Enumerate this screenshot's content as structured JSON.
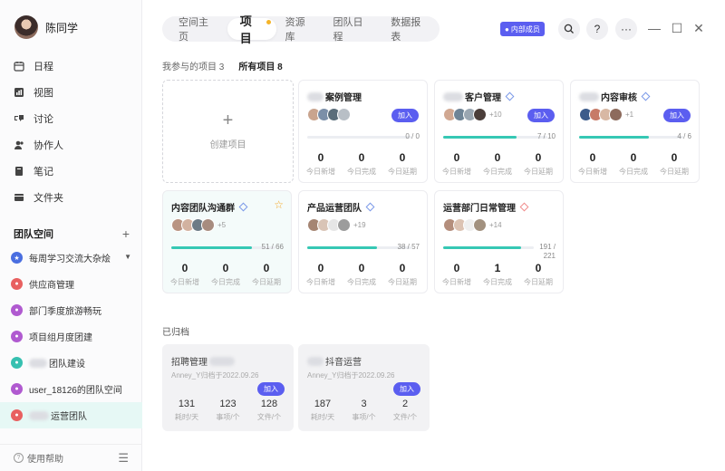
{
  "user": {
    "name": "陈同学"
  },
  "nav": [
    {
      "label": "日程",
      "icon": "calendar-icon"
    },
    {
      "label": "视图",
      "icon": "chart-icon"
    },
    {
      "label": "讨论",
      "icon": "discussion-icon"
    },
    {
      "label": "协作人",
      "icon": "people-icon"
    },
    {
      "label": "笔记",
      "icon": "notebook-icon"
    },
    {
      "label": "文件夹",
      "icon": "folder-icon"
    }
  ],
  "team_space": {
    "title": "团队空间",
    "add": "+",
    "items": [
      {
        "label": "每周学习交流大杂烩",
        "icon_color": "#4a6ee0"
      },
      {
        "label": "供应商管理",
        "icon_color": "#e86060"
      },
      {
        "label": "部门季度旅游畅玩",
        "icon_color": "#b05ad0"
      },
      {
        "label": "项目组月度团建",
        "icon_color": "#b05ad0"
      },
      {
        "label": "团队建设",
        "icon_color": "#36c0b0"
      },
      {
        "label": "user_18126的团队空间",
        "icon_color": "#b05ad0"
      },
      {
        "label": "运营团队",
        "icon_color": "#e86060"
      }
    ]
  },
  "footer": {
    "help": "使用帮助"
  },
  "tabs": [
    "空间主页",
    "项目",
    "资源库",
    "团队日程",
    "数据报表"
  ],
  "member_badge": "内部成员",
  "filter": {
    "mine": "我参与的项目 3",
    "all": "所有项目 8"
  },
  "create_label": "创建项目",
  "stat_labels": [
    "今日新增",
    "今日完成",
    "今日延期"
  ],
  "join_label": "加入",
  "projects": [
    {
      "title": "案例管理",
      "progress_text": "0 / 0",
      "progress": 0,
      "avatars_extra": "",
      "stats": [
        "0",
        "0",
        "0"
      ]
    },
    {
      "title": "客户管理",
      "progress_text": "7 / 10",
      "progress": 0.7,
      "avatars_extra": "+10",
      "stats": [
        "0",
        "0",
        "0"
      ]
    },
    {
      "title": "内容审核",
      "progress_text": "4 / 6",
      "progress": 0.67,
      "avatars_extra": "+1",
      "stats": [
        "0",
        "0",
        "0"
      ]
    },
    {
      "title": "内容团队沟通群",
      "progress_text": "51 / 66",
      "progress": 0.77,
      "avatars_extra": "+5",
      "stats": [
        "0",
        "0",
        "0"
      ]
    },
    {
      "title": "产品运营团队",
      "progress_text": "38 / 57",
      "progress": 0.67,
      "avatars_extra": "+19",
      "stats": [
        "0",
        "0",
        "0"
      ]
    },
    {
      "title": "运营部门日常管理",
      "progress_text": "191 / 221",
      "progress": 0.86,
      "avatars_extra": "+14",
      "stats": [
        "0",
        "1",
        "0"
      ]
    }
  ],
  "archived": {
    "title": "已归档",
    "stat_labels": [
      "耗时/天",
      "事项/个",
      "文件/个"
    ],
    "items": [
      {
        "title": "招聘管理",
        "sub": "Anney_Y归档于2022.09.26",
        "stats": [
          "131",
          "123",
          "128"
        ]
      },
      {
        "title": "抖音运营",
        "sub": "Anney_Y归档于2022.09.26",
        "stats": [
          "187",
          "3",
          "2"
        ]
      }
    ]
  }
}
